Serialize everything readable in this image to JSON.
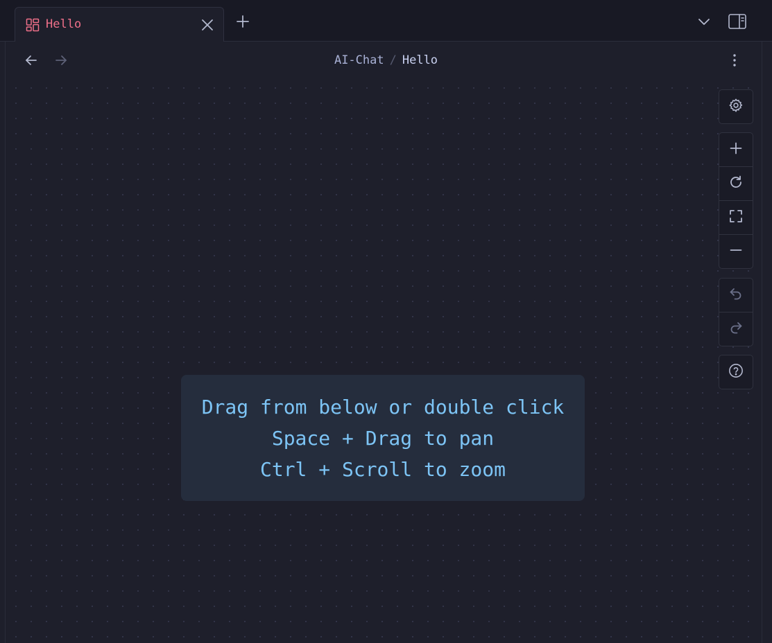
{
  "tabs": [
    {
      "label": "Hello",
      "icon": "dashboard-grid-icon",
      "active": true
    }
  ],
  "breadcrumb": {
    "parent": "AI-Chat",
    "separator": "/",
    "current": "Hello"
  },
  "canvas_hint": {
    "lines": [
      "Drag from below or double click",
      "Space + Drag to pan",
      "Ctrl + Scroll to zoom"
    ]
  },
  "toolbar": {
    "groups": [
      [
        "gear-icon"
      ],
      [
        "plus-icon",
        "refresh-icon",
        "fullscreen-icon",
        "minus-icon"
      ],
      [
        "undo-icon",
        "redo-icon"
      ],
      [
        "help-icon"
      ]
    ]
  },
  "colors": {
    "background": "#1e1f2b",
    "tab_active_text": "#f0708a",
    "hint_text": "#7dc4f5",
    "hint_background": "#252d3d",
    "icon": "#b4b9cf"
  }
}
